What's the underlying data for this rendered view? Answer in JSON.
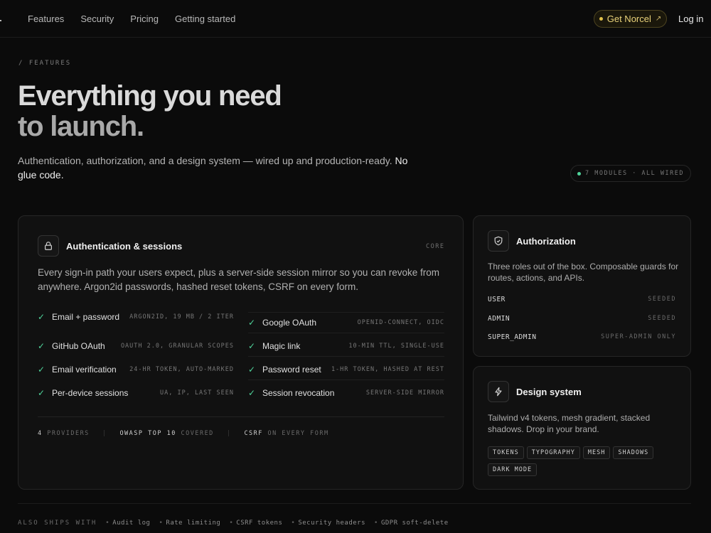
{
  "nav": {
    "links": [
      "Features",
      "Security",
      "Pricing",
      "Getting started"
    ],
    "cta_label": "Get Norcel",
    "cta_arrow": "↗",
    "login_label": "Log in"
  },
  "hero": {
    "eyebrow": "/  FEATURES",
    "title_line1": "Everything you need",
    "title_line2": "to launch.",
    "lead": "Authentication, authorization, and a design system — wired up and production-ready.",
    "lead_strong": "No glue code.",
    "pill": "7 MODULES · ALL WIRED"
  },
  "auth_card": {
    "title": "Authentication & sessions",
    "tag": "CORE",
    "description": "Every sign-in path your users expect, plus a server-side session mirror so you can revoke from anywhere. Argon2id passwords, hashed reset tokens, CSRF on every form.",
    "features_left": [
      {
        "label": "Email + password",
        "detail": "ARGON2ID, 19 MB / 2 ITER"
      },
      {
        "label": "GitHub OAuth",
        "detail": "OAUTH 2.0, GRANULAR SCOPES"
      },
      {
        "label": "Email verification",
        "detail": "24-HR TOKEN, AUTO-MARKED"
      },
      {
        "label": "Per-device sessions",
        "detail": "UA, IP, LAST SEEN"
      }
    ],
    "features_right": [
      {
        "label": "Google OAuth",
        "detail": "OPENID-CONNECT, OIDC"
      },
      {
        "label": "Magic link",
        "detail": "10-MIN TTL, SINGLE-USE"
      },
      {
        "label": "Password reset",
        "detail": "1-HR TOKEN, HASHED AT REST"
      },
      {
        "label": "Session revocation",
        "detail": "SERVER-SIDE MIRROR"
      }
    ],
    "stats": [
      {
        "strong": "4",
        "rest": " PROVIDERS"
      },
      {
        "strong": "OWASP TOP 10",
        "rest": " COVERED"
      },
      {
        "strong": "CSRF",
        "rest": " ON EVERY FORM"
      }
    ]
  },
  "authz_card": {
    "title": "Authorization",
    "description": "Three roles out of the box. Composable guards for routes, actions, and APIs.",
    "roles": [
      {
        "name": "USER",
        "status": "SEEDED"
      },
      {
        "name": "ADMIN",
        "status": "SEEDED"
      },
      {
        "name": "SUPER_ADMIN",
        "status": "SUPER-ADMIN ONLY"
      }
    ]
  },
  "design_card": {
    "title": "Design system",
    "description": "Tailwind v4 tokens, mesh gradient, stacked shadows. Drop in your brand.",
    "tags": [
      "TOKENS",
      "TYPOGRAPHY",
      "MESH",
      "SHADOWS",
      "DARK MODE"
    ]
  },
  "footer": {
    "label": "ALSO SHIPS WITH",
    "items": [
      "Audit log",
      "Rate limiting",
      "CSRF tokens",
      "Security headers",
      "GDPR soft-delete"
    ]
  },
  "colors": {
    "background": "#0b0b0b",
    "accent_gold": "#e2c24a",
    "accent_green": "#4fd39a"
  }
}
